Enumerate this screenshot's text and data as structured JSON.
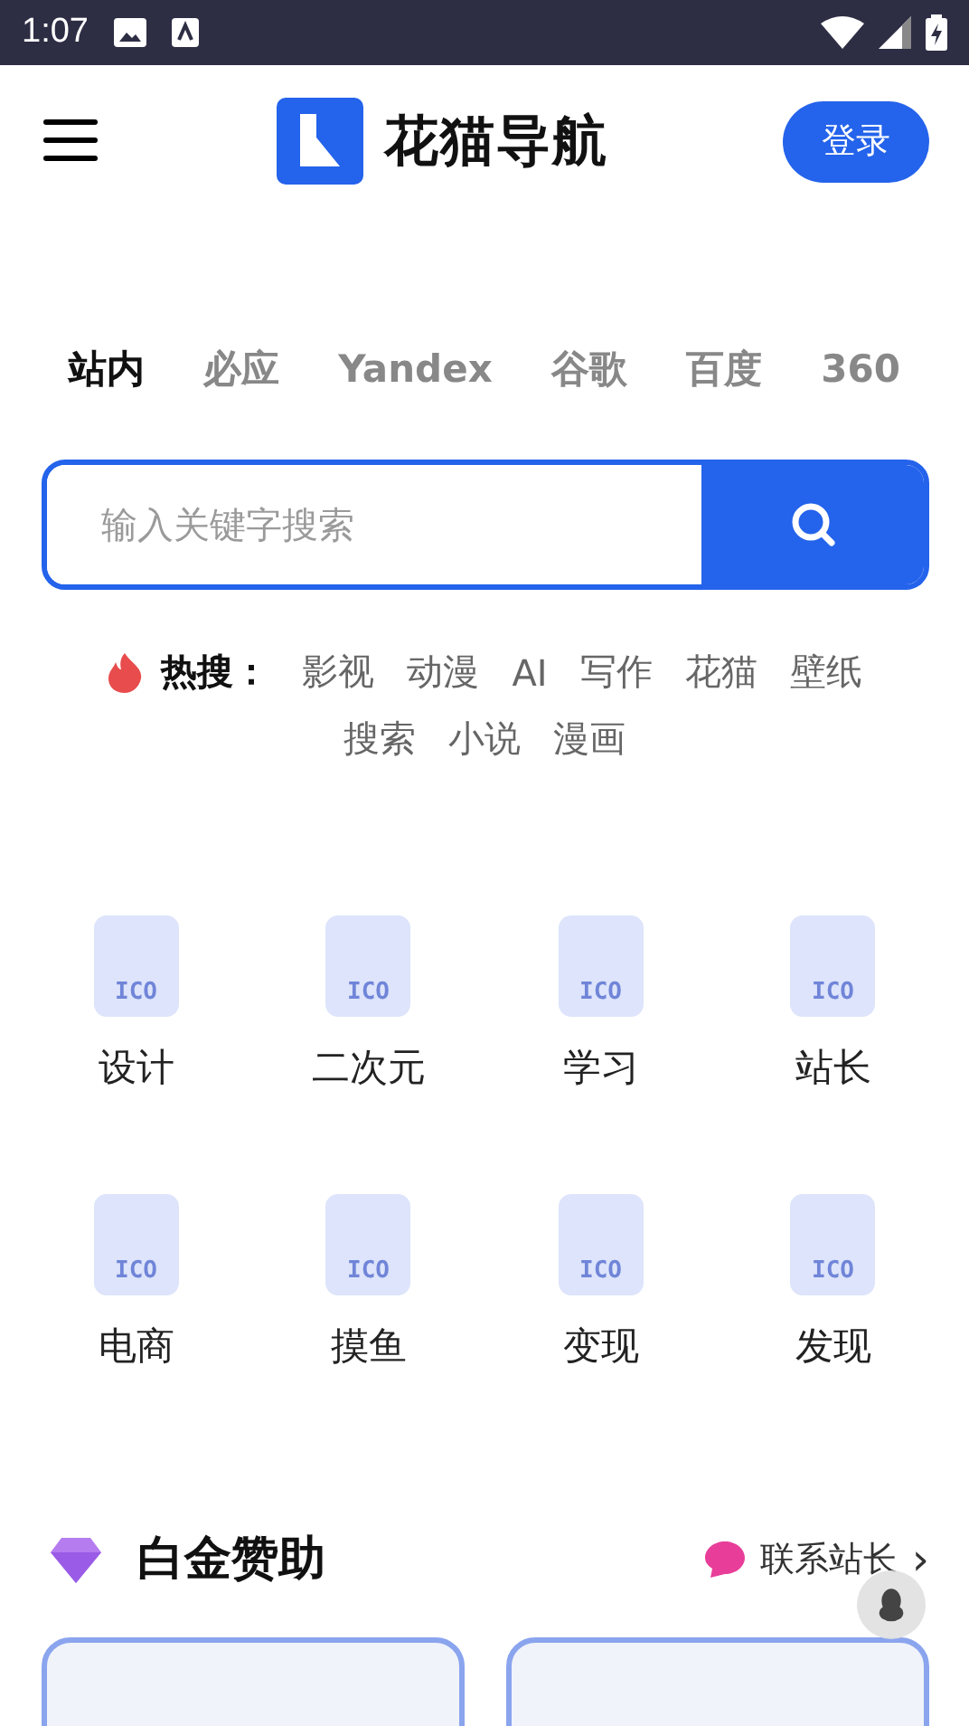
{
  "status_bar": {
    "time": "1:07"
  },
  "header": {
    "title": "花猫导航",
    "login_button": "登录"
  },
  "engines": [
    {
      "label": "站内",
      "selected": true
    },
    {
      "label": "必应",
      "selected": false
    },
    {
      "label": "Yandex",
      "selected": false
    },
    {
      "label": "谷歌",
      "selected": false
    },
    {
      "label": "百度",
      "selected": false
    },
    {
      "label": "360",
      "selected": false
    }
  ],
  "search": {
    "placeholder": "输入关键字搜索"
  },
  "hot_search": {
    "label": "热搜：",
    "tags": [
      "影视",
      "动漫",
      "AI",
      "写作",
      "花猫",
      "壁纸",
      "搜索",
      "小说",
      "漫画"
    ]
  },
  "categories": [
    {
      "label": "设计",
      "icon_text": "ICO"
    },
    {
      "label": "二次元",
      "icon_text": "ICO"
    },
    {
      "label": "学习",
      "icon_text": "ICO"
    },
    {
      "label": "站长",
      "icon_text": "ICO"
    },
    {
      "label": "电商",
      "icon_text": "ICO"
    },
    {
      "label": "摸鱼",
      "icon_text": "ICO"
    },
    {
      "label": "变现",
      "icon_text": "ICO"
    },
    {
      "label": "发现",
      "icon_text": "ICO"
    }
  ],
  "sponsor": {
    "title": "白金赞助",
    "contact_link": "联系站长",
    "chevron": "›",
    "cards": [
      {
        "kind": "empty"
      },
      {
        "kind": "empty"
      }
    ]
  }
}
